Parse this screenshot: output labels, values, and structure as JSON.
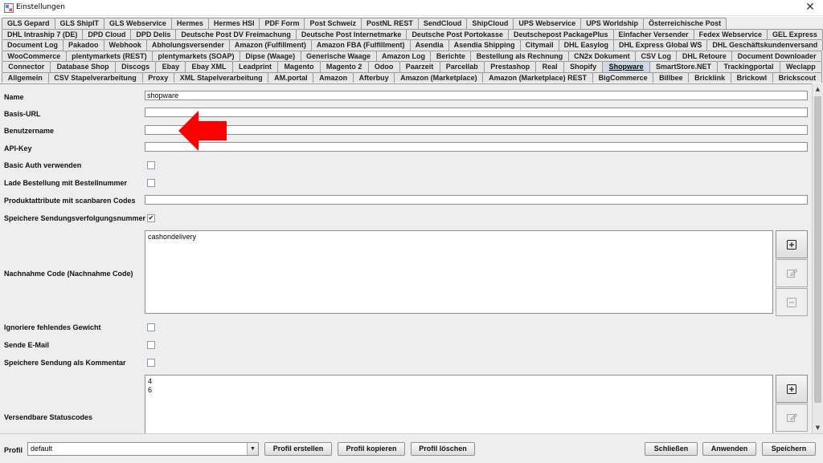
{
  "window": {
    "title": "Einstellungen"
  },
  "tabs": {
    "rows": [
      [
        "GLS Gepard",
        "GLS ShipIT",
        "GLS Webservice",
        "Hermes",
        "Hermes HSI",
        "PDF Form",
        "Post Schweiz",
        "PostNL REST",
        "SendCloud",
        "ShipCloud",
        "UPS Webservice",
        "UPS Worldship",
        "Österreichische Post"
      ],
      [
        "DHL Intraship 7 (DE)",
        "DPD Cloud",
        "DPD Delis",
        "Deutsche Post DV Freimachung",
        "Deutsche Post Internetmarke",
        "Deutsche Post Portokasse",
        "Deutschepost PackagePlus",
        "Einfacher Versender",
        "Fedex Webservice",
        "GEL Express"
      ],
      [
        "Document Log",
        "Pakadoo",
        "Webhook",
        "Abholungsversender",
        "Amazon (Fulfillment)",
        "Amazon FBA (Fulfillment)",
        "Asendia",
        "Asendia Shipping",
        "Citymail",
        "DHL Easylog",
        "DHL Express Global WS",
        "DHL Geschäftskundenversand"
      ],
      [
        "WooCommerce",
        "plentymarkets (REST)",
        "plentymarkets (SOAP)",
        "Dipse (Waage)",
        "Generische Waage",
        "Amazon Log",
        "Berichte",
        "Bestellung als Rechnung",
        "CN2x Dokument",
        "CSV Log",
        "DHL Retoure",
        "Document Downloader"
      ],
      [
        "Connector",
        "Database Shop",
        "Discogs",
        "Ebay",
        "Ebay XML",
        "Leadprint",
        "Magento",
        "Magento 2",
        "Odoo",
        "Paarzeit",
        "Parcellab",
        "Prestashop",
        "Real",
        "Shopify",
        "Shopware",
        "SmartStore.NET",
        "Trackingportal",
        "Weclapp"
      ],
      [
        "Allgemein",
        "CSV Stapelverarbeitung",
        "Proxy",
        "XML Stapelverarbeitung",
        "AM.portal",
        "Amazon",
        "Afterbuy",
        "Amazon (Marketplace)",
        "Amazon (Marketplace) REST",
        "BigCommerce",
        "Billbee",
        "Bricklink",
        "Brickowl",
        "Brickscout"
      ]
    ],
    "active": "Shopware"
  },
  "form": {
    "name_label": "Name",
    "name_value": "shopware",
    "basis_url_label": "Basis-URL",
    "basis_url_value": "",
    "benutzername_label": "Benutzername",
    "benutzername_value": "",
    "api_key_label": "API-Key",
    "api_key_value": "",
    "basic_auth_label": "Basic Auth verwenden",
    "basic_auth_checked": false,
    "lade_bestellung_label": "Lade Bestellung mit Bestellnummer",
    "lade_bestellung_checked": false,
    "produktattribute_label": "Produktattribute mit scanbaren Codes",
    "produktattribute_value": "",
    "speichere_tracking_label": "Speichere Sendungsverfolgungsnummer",
    "speichere_tracking_checked": true,
    "speichere_tracking_mark": "✔",
    "nachnahme_label": "Nachnahme Code (Nachnahme Code)",
    "nachnahme_values": [
      "cashondelivery"
    ],
    "ignoriere_gewicht_label": "Ignoriere fehlendes Gewicht",
    "ignoriere_gewicht_checked": false,
    "sende_email_label": "Sende E-Mail",
    "sende_email_checked": false,
    "speichere_kommentar_label": "Speichere Sendung als Kommentar",
    "speichere_kommentar_checked": false,
    "statuscodes_label": "Versendbare Statuscodes",
    "statuscodes_values": [
      "4",
      "6"
    ]
  },
  "bottom": {
    "profil_label": "Profil",
    "profil_value": "default",
    "profil_erstellen": "Profil erstellen",
    "profil_kopieren": "Profil kopieren",
    "profil_loeschen": "Profil löschen",
    "schliessen": "Schließen",
    "anwenden": "Anwenden",
    "speichern": "Speichern"
  },
  "colors": {
    "arrow": "#ff0000",
    "active_tab": "#ccd9e8",
    "panel": "#eeeeee"
  },
  "icons": {
    "add": "add-icon",
    "edit": "edit-icon",
    "remove": "remove-icon",
    "arrow_annotation": "red-arrow-icon"
  }
}
